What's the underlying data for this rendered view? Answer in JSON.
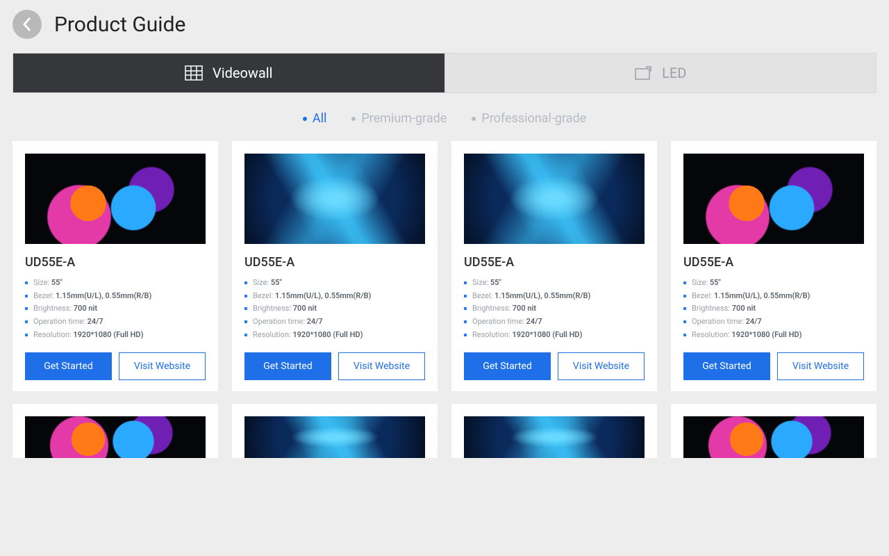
{
  "header": {
    "title": "Product Guide"
  },
  "tabs": [
    {
      "label": "Videowall",
      "active": true
    },
    {
      "label": "LED",
      "active": false
    }
  ],
  "filters": [
    {
      "label": "All",
      "active": true
    },
    {
      "label": "Premium-grade",
      "active": false
    },
    {
      "label": "Professional-grade",
      "active": false
    }
  ],
  "spec_labels": {
    "size": "Size",
    "bezel": "Bezel",
    "brightness": "Brightness",
    "operation": "Operation time",
    "resolution": "Resolution"
  },
  "buttons": {
    "get_started": "Get Started",
    "visit_website": "Visit Website"
  },
  "products": [
    {
      "name": "UD55E-A",
      "thumb": "splash",
      "size": "55\"",
      "bezel": "1.15mm(U/L), 0.55mm(R/B)",
      "brightness": "700 nit",
      "operation": "24/7",
      "resolution": "1920*1080 (Full HD)"
    },
    {
      "name": "UD55E-A",
      "thumb": "wave",
      "size": "55\"",
      "bezel": "1.15mm(U/L), 0.55mm(R/B)",
      "brightness": "700 nit",
      "operation": "24/7",
      "resolution": "1920*1080 (Full HD)"
    },
    {
      "name": "UD55E-A",
      "thumb": "wave",
      "size": "55\"",
      "bezel": "1.15mm(U/L), 0.55mm(R/B)",
      "brightness": "700 nit",
      "operation": "24/7",
      "resolution": "1920*1080 (Full HD)"
    },
    {
      "name": "UD55E-A",
      "thumb": "splash",
      "size": "55\"",
      "bezel": "1.15mm(U/L), 0.55mm(R/B)",
      "brightness": "700 nit",
      "operation": "24/7",
      "resolution": "1920*1080 (Full HD)"
    }
  ],
  "row2_thumbs": [
    "splash",
    "wave",
    "wave",
    "splash"
  ]
}
